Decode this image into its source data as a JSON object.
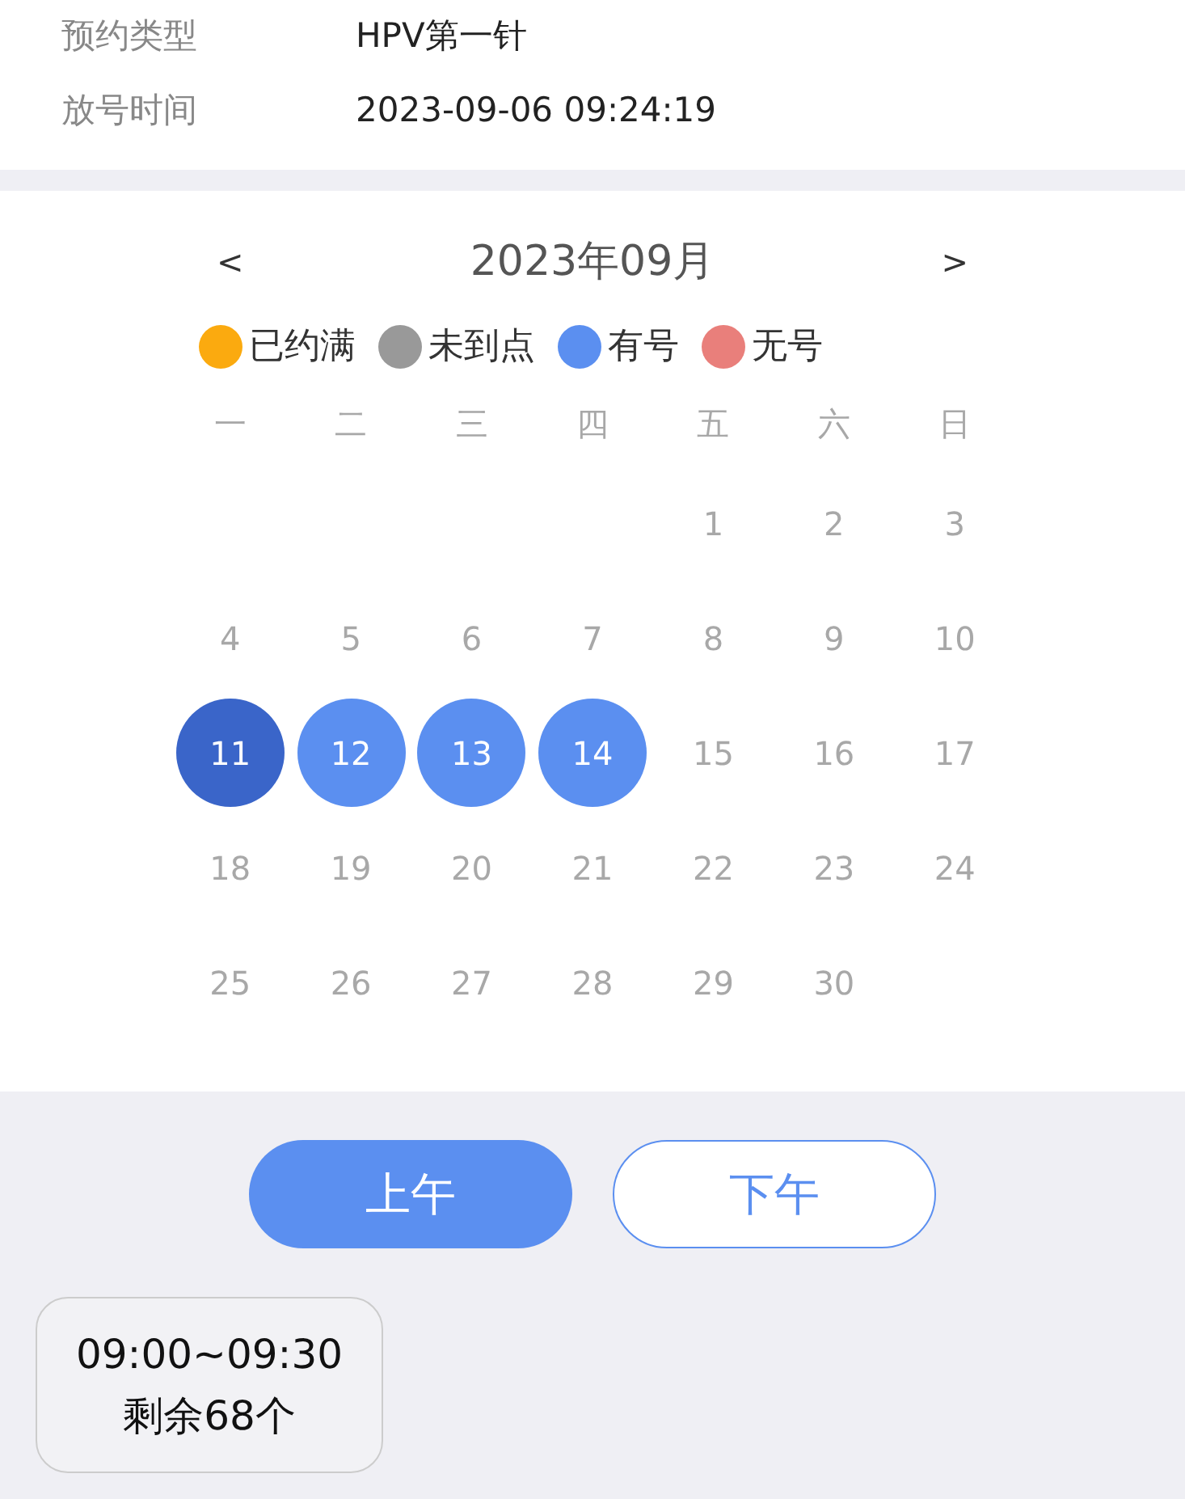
{
  "info": [
    {
      "label": "预约类型",
      "value": "HPV第一针"
    },
    {
      "label": "放号时间",
      "value": "2023-09-06 09:24:19"
    }
  ],
  "calendar": {
    "prev": "<",
    "title": "2023年09月",
    "next": ">",
    "legend": [
      {
        "label": "已约满",
        "color": "#fbaa0f"
      },
      {
        "label": "未到点",
        "color": "#999999"
      },
      {
        "label": "有号",
        "color": "#5b8ff0"
      },
      {
        "label": "无号",
        "color": "#e97f7b"
      }
    ],
    "weekdays": [
      "一",
      "二",
      "三",
      "四",
      "五",
      "六",
      "日"
    ],
    "weeks": [
      [
        {
          "day": "1",
          "available": false,
          "selected": false
        },
        {
          "day": "2",
          "available": false,
          "selected": false
        },
        {
          "day": "3",
          "available": false,
          "selected": false
        }
      ],
      [
        {
          "day": "4",
          "available": false,
          "selected": false
        },
        {
          "day": "5",
          "available": false,
          "selected": false
        },
        {
          "day": "6",
          "available": false,
          "selected": false
        },
        {
          "day": "7",
          "available": false,
          "selected": false
        },
        {
          "day": "8",
          "available": false,
          "selected": false
        },
        {
          "day": "9",
          "available": false,
          "selected": false
        },
        {
          "day": "10",
          "available": false,
          "selected": false
        }
      ],
      [
        {
          "day": "11",
          "available": true,
          "selected": true
        },
        {
          "day": "12",
          "available": true,
          "selected": false
        },
        {
          "day": "13",
          "available": true,
          "selected": false
        },
        {
          "day": "14",
          "available": true,
          "selected": false
        },
        {
          "day": "15",
          "available": false,
          "selected": false
        },
        {
          "day": "16",
          "available": false,
          "selected": false
        },
        {
          "day": "17",
          "available": false,
          "selected": false
        }
      ],
      [
        {
          "day": "18",
          "available": false,
          "selected": false
        },
        {
          "day": "19",
          "available": false,
          "selected": false
        },
        {
          "day": "20",
          "available": false,
          "selected": false
        },
        {
          "day": "21",
          "available": false,
          "selected": false
        },
        {
          "day": "22",
          "available": false,
          "selected": false
        },
        {
          "day": "23",
          "available": false,
          "selected": false
        },
        {
          "day": "24",
          "available": false,
          "selected": false
        }
      ],
      [
        {
          "day": "25",
          "available": false,
          "selected": false
        },
        {
          "day": "26",
          "available": false,
          "selected": false
        },
        {
          "day": "27",
          "available": false,
          "selected": false
        },
        {
          "day": "28",
          "available": false,
          "selected": false
        },
        {
          "day": "29",
          "available": false,
          "selected": false
        },
        {
          "day": "30",
          "available": false,
          "selected": false
        }
      ]
    ]
  },
  "periods": [
    {
      "label": "上午",
      "selected": true
    },
    {
      "label": "下午",
      "selected": false
    }
  ],
  "slots": [
    {
      "time": "09:00~09:30",
      "remaining": "剩余68个"
    }
  ]
}
